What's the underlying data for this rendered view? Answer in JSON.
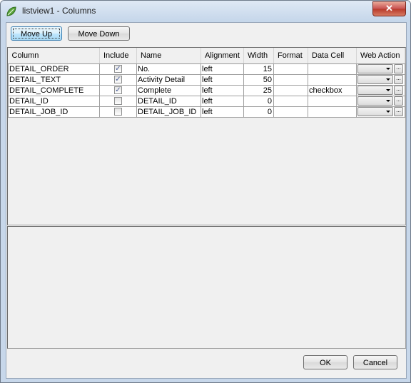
{
  "window": {
    "title": "listview1 - Columns",
    "close_label": "✕"
  },
  "toolbar": {
    "move_up_label": "Move Up",
    "move_down_label": "Move Down"
  },
  "grid": {
    "headers": [
      "Column",
      "Include",
      "Name",
      "Alignment",
      "Width",
      "Format",
      "Data Cell",
      "Web Action"
    ],
    "rows": [
      {
        "column": "DETAIL_ORDER",
        "include": true,
        "name": "No.",
        "alignment": "left",
        "width": "15",
        "format": "",
        "data_cell": "",
        "web_action": ""
      },
      {
        "column": "DETAIL_TEXT",
        "include": true,
        "name": "Activity Detail",
        "alignment": "left",
        "width": "50",
        "format": "",
        "data_cell": "",
        "web_action": ""
      },
      {
        "column": "DETAIL_COMPLETE",
        "include": true,
        "name": "Complete",
        "alignment": "left",
        "width": "25",
        "format": "",
        "data_cell": "checkbox",
        "web_action": ""
      },
      {
        "column": "DETAIL_ID",
        "include": false,
        "name": "DETAIL_ID",
        "alignment": "left",
        "width": "0",
        "format": "",
        "data_cell": "",
        "web_action": ""
      },
      {
        "column": "DETAIL_JOB_ID",
        "include": false,
        "name": "DETAIL_JOB_ID",
        "alignment": "left",
        "width": "0",
        "format": "",
        "data_cell": "",
        "web_action": ""
      }
    ],
    "ellipsis_label": "..."
  },
  "footer": {
    "ok_label": "OK",
    "cancel_label": "Cancel"
  },
  "icons": {
    "app": "leaf-icon",
    "close": "close-icon",
    "checkbox": "checkmark-icon",
    "dropdown": "chevron-down-icon"
  },
  "colors": {
    "title_bar": "#c7d7ea",
    "close_button": "#c75050",
    "client": "#f0f0f0",
    "check": "#4a5f97"
  }
}
